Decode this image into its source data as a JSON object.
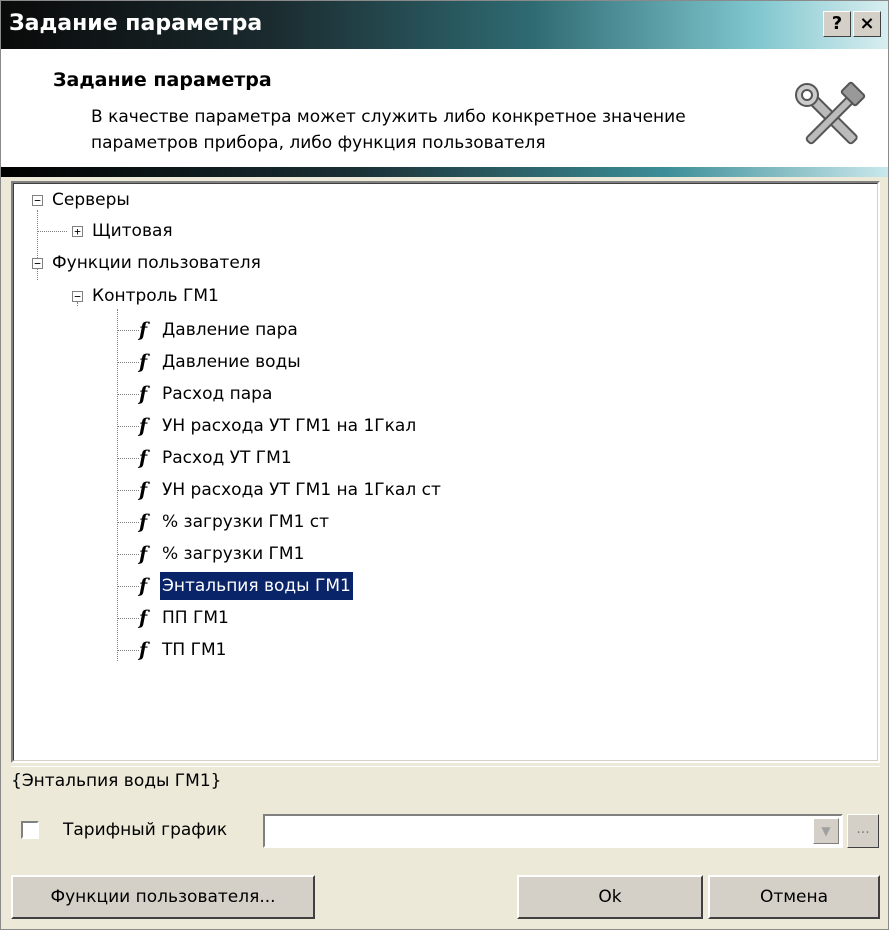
{
  "window": {
    "title": "Задание параметра",
    "help_label": "?",
    "close_label": "×"
  },
  "header": {
    "title": "Задание параметра",
    "description": "В качестве параметра может служить либо конкретное значение параметров прибора, либо  функция пользователя",
    "icon": "tools-icon"
  },
  "tree": {
    "servers": {
      "label": "Серверы",
      "expander": "−"
    },
    "shchitovaya": {
      "label": "Щитовая",
      "expander": "+"
    },
    "user_functions": {
      "label": "Функции пользователя",
      "expander": "−"
    },
    "control": {
      "label": "Контроль ГМ1",
      "expander": "−"
    },
    "fn_glyph": "f",
    "functions": [
      "Давление пара",
      "Давление воды",
      "Расход пара",
      "УН расхода УТ ГМ1 на 1Гкал",
      "Расход УТ ГМ1",
      "УН расхода УТ ГМ1 на 1Гкал ст",
      "% загрузки ГМ1 ст",
      "% загрузки ГМ1",
      "Энтальпия воды ГМ1",
      "ПП ГМ1",
      "ТП ГМ1"
    ],
    "selected_function": "Энтальпия воды ГМ1"
  },
  "status": {
    "text": "{Энтальпия воды ГМ1}"
  },
  "tariff": {
    "checkbox_label": "Тарифный график",
    "checked": false,
    "value": "",
    "combo_arrow": "▼",
    "browse_label": "..."
  },
  "buttons": {
    "user_functions": "Функции пользователя...",
    "ok": "Ok",
    "cancel": "Отмена"
  }
}
